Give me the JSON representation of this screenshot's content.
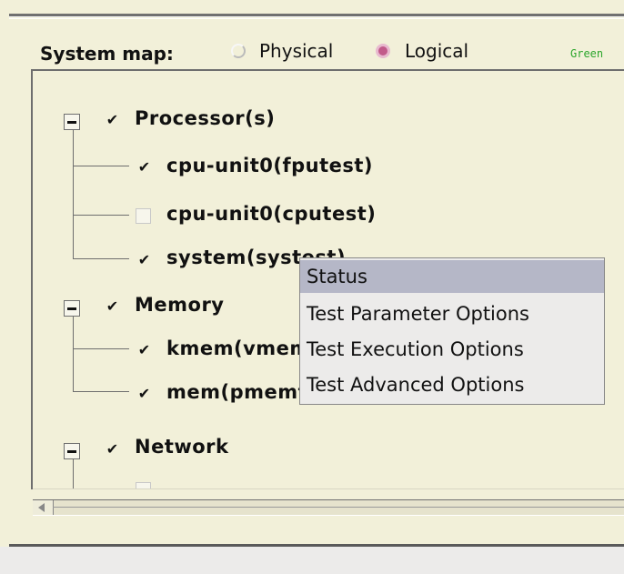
{
  "system_map": {
    "label": "System map:",
    "options": [
      {
        "label": "Physical",
        "selected": false
      },
      {
        "label": "Logical",
        "selected": true
      }
    ],
    "status_text": "Green"
  },
  "tree": [
    {
      "label": "Processor(s)",
      "checked": true,
      "expanded": true,
      "children": [
        {
          "label": "cpu-unit0(fputest)",
          "checked": true
        },
        {
          "label": "cpu-unit0(cputest)",
          "checked": false
        },
        {
          "label": "system(systest)",
          "checked": true
        }
      ]
    },
    {
      "label": "Memory",
      "checked": true,
      "expanded": true,
      "children": [
        {
          "label": "kmem(vmemtest)",
          "checked": true
        },
        {
          "label": "mem(pmemtest)",
          "checked": true
        }
      ]
    },
    {
      "label": "Network",
      "checked": true,
      "expanded": true,
      "children": []
    }
  ],
  "context_menu": {
    "items": [
      "Status",
      "Test Parameter Options",
      "Test Execution Options",
      "Test Advanced Options"
    ],
    "selected_index": 0
  },
  "icons": {
    "checkmark": "✔",
    "collapse": "minus-box-icon"
  }
}
